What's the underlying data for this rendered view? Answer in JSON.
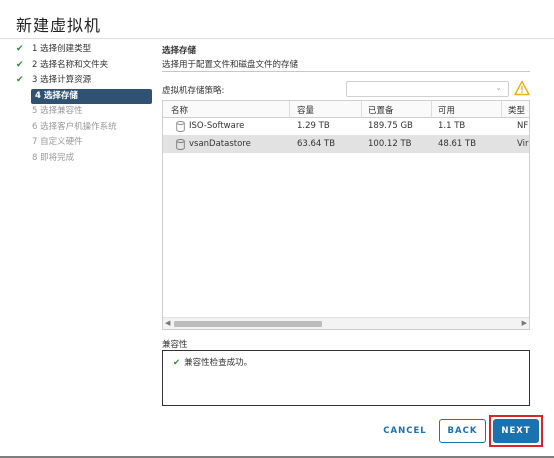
{
  "window": {
    "title": "新建虚拟机"
  },
  "steps": [
    {
      "label": "1 选择创建类型",
      "state": "done"
    },
    {
      "label": "2 选择名称和文件夹",
      "state": "done"
    },
    {
      "label": "3 选择计算资源",
      "state": "done"
    },
    {
      "label": "4 选择存储",
      "state": "active"
    },
    {
      "label": "5 选择兼容性",
      "state": "disabled"
    },
    {
      "label": "6 选择客户机操作系统",
      "state": "disabled"
    },
    {
      "label": "7 自定义硬件",
      "state": "disabled"
    },
    {
      "label": "8 即将完成",
      "state": "disabled"
    }
  ],
  "section": {
    "title": "选择存储",
    "subtitle": "选择用于配置文件和磁盘文件的存储"
  },
  "policy": {
    "label": "虚拟机存储策略:",
    "value": ""
  },
  "table": {
    "columns": [
      "名称",
      "容量",
      "已置备",
      "可用",
      "类型"
    ],
    "rows": [
      {
        "name": "ISO-Software",
        "capacity": "1.29 TB",
        "provisioned": "189.75 GB",
        "free": "1.1 TB",
        "type": "NF",
        "selected": false
      },
      {
        "name": "vsanDatastore",
        "capacity": "63.64 TB",
        "provisioned": "100.12 TB",
        "free": "48.61 TB",
        "type": "Vir",
        "selected": true
      }
    ]
  },
  "compatibility": {
    "label": "兼容性",
    "message": "兼容性检查成功。"
  },
  "buttons": {
    "cancel": "CANCEL",
    "back": "BACK",
    "next": "NEXT"
  },
  "colors": {
    "active_step": "#2f5272",
    "primary": "#1a72b0",
    "success": "#2e8b3e",
    "warning": "#e8b21a",
    "highlight": "#d9242b"
  }
}
